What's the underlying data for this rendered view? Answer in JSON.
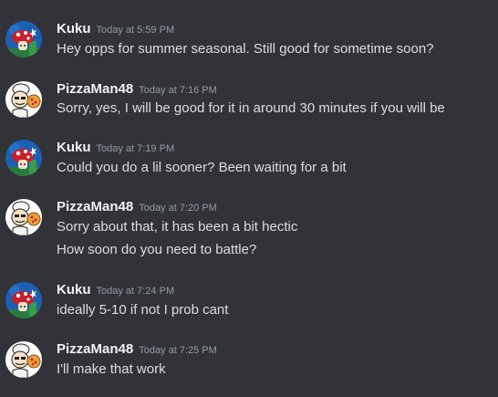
{
  "messages": [
    {
      "author": "Kuku",
      "timestamp": "Today at 5:59 PM",
      "lines": [
        "Hey opps for summer seasonal. Still good for sometime soon?"
      ]
    },
    {
      "author": "PizzaMan48",
      "timestamp": "Today at 7:16 PM",
      "lines": [
        "Sorry, yes, I will be good for it in around 30 minutes if you will be"
      ]
    },
    {
      "author": "Kuku",
      "timestamp": "Today at 7:19 PM",
      "lines": [
        "Could you do a lil sooner? Been waiting for a bit"
      ]
    },
    {
      "author": "PizzaMan48",
      "timestamp": "Today at 7:20 PM",
      "lines": [
        "Sorry about that, it has been a bit hectic",
        "How soon do you need to battle?"
      ]
    },
    {
      "author": "Kuku",
      "timestamp": "Today at 7:24 PM",
      "lines": [
        "ideally 5-10 if not I prob cant"
      ]
    },
    {
      "author": "PizzaMan48",
      "timestamp": "Today at 7:25 PM",
      "lines": [
        "I'll make that work"
      ]
    }
  ],
  "colors": {
    "background": "#313338",
    "username": "#f2f3f5",
    "message_text": "#dbdee1",
    "timestamp": "#949ba4"
  },
  "avatars": {
    "Kuku": "mushroom-avatar-icon",
    "PizzaMan48": "pizza-chef-avatar-icon"
  }
}
